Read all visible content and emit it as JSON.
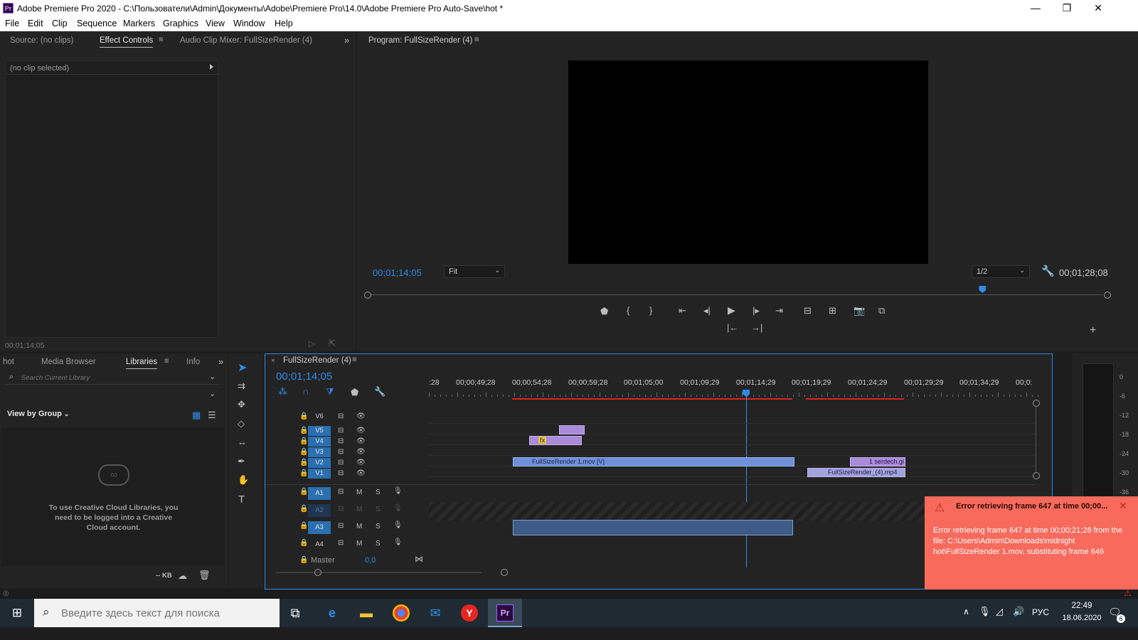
{
  "window": {
    "logo": "Pr",
    "title": "Adobe Premiere Pro 2020 - C:\\Пользователи\\Admin\\Документы\\Adobe\\Premiere Pro\\14.0\\Adobe Premiere Pro Auto-Save\\hot *",
    "minimize": "—",
    "restore": "❐",
    "close": "✕"
  },
  "menu": [
    "File",
    "Edit",
    "Clip",
    "Sequence",
    "Markers",
    "Graphics",
    "View",
    "Window",
    "Help"
  ],
  "source_panel": {
    "tabs": [
      "Source: (no clips)",
      "Effect Controls",
      "Audio Clip Mixer: FullSizeRender (4)"
    ],
    "active_tab": "Effect Controls",
    "tab_menu": "≡",
    "overflow": "»",
    "no_clip": "(no clip selected)",
    "timecode": "00;01;14;05"
  },
  "program_monitor": {
    "title": "Program: FullSizeRender (4)",
    "menu_icon": "≡",
    "timecode": "00;01;14;05",
    "fit": "Fit",
    "resolution": "1/2",
    "duration": "00;01;28;08",
    "playhead_fraction": 0.836
  },
  "project_panel": {
    "tabs": [
      "hot",
      "Media Browser",
      "Libraries",
      "Info"
    ],
    "active_tab": "Libraries",
    "overflow": "»",
    "search_placeholder": "Search Current Library",
    "view_by": "View by Group",
    "message": "To use Creative Cloud Libraries, you need to be logged into a Creative Cloud account.",
    "storage": "-- KB"
  },
  "timeline": {
    "tab": "FullSizeRender (4)",
    "close": "×",
    "menu": "≡",
    "timecode": "00;01;14;05",
    "ruler": [
      ":28",
      "00;00;49;28",
      "00;00;54;28",
      "00;00;59;28",
      "00;01;05;00",
      "00;01;09;29",
      "00;01;14;29",
      "00;01;19;29",
      "00;01;24;29",
      "00;01;29;29",
      "00;01;34;29",
      "00;0:"
    ],
    "video_tracks": [
      "V6",
      "V5",
      "V4",
      "V3",
      "V2",
      "V1"
    ],
    "active_video": [
      "V5",
      "V4",
      "V3",
      "V2",
      "V1"
    ],
    "audio_tracks": [
      {
        "name": "A1",
        "m": "M",
        "s": "S"
      },
      {
        "name": "A2",
        "m": "M",
        "s": "S"
      },
      {
        "name": "A3",
        "m": "M",
        "s": "S"
      },
      {
        "name": "A4",
        "m": "M",
        "s": "S"
      }
    ],
    "master": {
      "label": "Master",
      "value": "0,0"
    },
    "clips": {
      "v2": "FullSizeRender 1.mov [V]",
      "v2b": "1 serdech.gi",
      "v1": "FullSizeRender_(4).mp4",
      "fx": "fx"
    }
  },
  "meter": {
    "levels": [
      "0",
      "-6",
      "-12",
      "-18",
      "-24",
      "-30",
      "-36"
    ]
  },
  "error": {
    "heading": "Error retrieving frame 647 at time 00;00...",
    "body": "Error retrieving frame 647 at time 00;00;21;28 from the file: C:\\Users\\Admin\\Downloads\\midnight hot\\FullSizeRender 1.mov, substituting frame 646",
    "close": "✕"
  },
  "taskbar": {
    "search_placeholder": "Введите здесь текст для поиска",
    "language": "РУС",
    "time": "22:49",
    "date": "18.06.2020",
    "notifications": "6"
  },
  "colors": {
    "accent_blue": "#2d8ceb",
    "error_bg": "#f76a5c",
    "playhead": "#2d8ceb",
    "work_area": "#e02020"
  }
}
